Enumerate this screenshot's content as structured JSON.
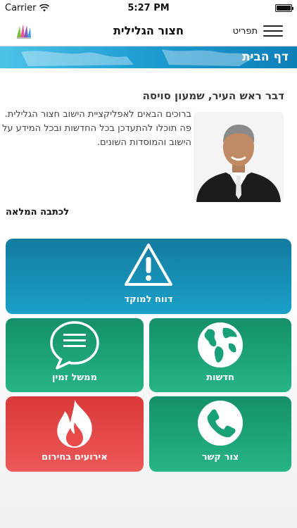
{
  "status_bar": {
    "carrier": "Carrier",
    "time": "5:27 PM"
  },
  "nav": {
    "title": "חצור הגלילית",
    "menu_label": "תפריט"
  },
  "banner": {
    "title": "דף הבית"
  },
  "mayor": {
    "heading": "דבר ראש העיר, שמעון סויסה",
    "intro": "ברוכים הבאים לאפליקציית הישוב חצור הגלילית. פה תוכלו להתעדכן בכל החדשות ובכל המידע על הישוב והמוסדות השונים.",
    "read_more": "לכתבה המלאה"
  },
  "tiles": {
    "report": "דווח למוקד",
    "government": "ממשל זמין",
    "news": "חדשות",
    "emergency": "אירועים בחירום",
    "contact": "צור קשר"
  },
  "colors": {
    "tile_blue": "#1aa0c8",
    "tile_green": "#1fa47a",
    "tile_red": "#e84848",
    "banner": "#1f9fd4"
  }
}
